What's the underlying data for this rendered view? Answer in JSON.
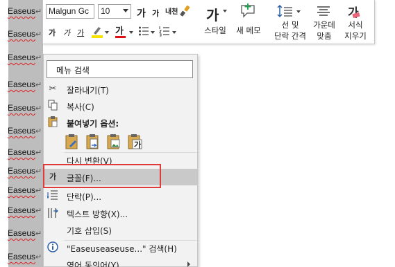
{
  "document": {
    "lines": [
      {
        "word": "Easeus",
        "mark": "↵"
      },
      {
        "word": "Easeus",
        "mark": "↵"
      },
      {
        "word": "Easeus",
        "mark": "↵"
      },
      {
        "word": "Easeus",
        "mark": "↵"
      },
      {
        "word": "Easeus",
        "mark": "↵"
      },
      {
        "word": "Easeus",
        "mark": "↵"
      },
      {
        "word": "Easeus",
        "mark": "↵"
      },
      {
        "word": "Easeus",
        "mark": "↵"
      },
      {
        "word": "Easeus",
        "mark": "↵"
      },
      {
        "word": "Easeus",
        "mark": "↵"
      },
      {
        "word": "Easeus",
        "mark": "↵"
      },
      {
        "word": "Easeus",
        "mark": "↵"
      },
      {
        "word": "Easeus",
        "mark": "↵"
      },
      {
        "word": "Easeus",
        "mark": "↵"
      }
    ]
  },
  "mini_toolbar": {
    "font_name": "Malgun Gc",
    "font_size": "10",
    "grow_font": "가",
    "shrink_font": "가",
    "phonetic": "내천",
    "bold": "가",
    "italic": "가",
    "underline": "가",
    "font_color": "가",
    "styles_glyph": "가",
    "styles_label": "스타일",
    "new_comment_label": "새 메모",
    "line_spacing_label_1": "선 및",
    "line_spacing_label_2": "단락 간격",
    "center_label_1": "가운데",
    "center_label_2": "맞춤",
    "clear_format_glyph": "가",
    "clear_format_label_1": "서식",
    "clear_format_label_2": "지우기",
    "colors": {
      "highlight": "#f5e400",
      "font_color": "#e01010",
      "styles": "#2d5fa8"
    }
  },
  "context_menu": {
    "search_label": "메뉴 검색",
    "items": [
      {
        "label": "잘라내기(T)",
        "icon": "scissors-icon"
      },
      {
        "label": "복사(C)",
        "icon": "copy-icon"
      },
      {
        "label": "붙여넣기 옵션:",
        "icon": "clipboard-icon"
      },
      {
        "label": "다시 변환(V)",
        "icon": ""
      },
      {
        "label": "글꼴(F)...",
        "icon": "font-icon"
      },
      {
        "label": "단락(P)...",
        "icon": "paragraph-icon"
      },
      {
        "label": "텍스트 방향(X)...",
        "icon": "text-direction-icon"
      },
      {
        "label": "기호 삽입(S)",
        "icon": ""
      },
      {
        "label": "\"Easeuseaseuse...\" 검색(H)",
        "icon": "search-info-icon"
      },
      {
        "label": "영어 동의어(Y)",
        "icon": ""
      }
    ],
    "paste_last_glyph": "가",
    "font_icon_glyph": "가"
  }
}
